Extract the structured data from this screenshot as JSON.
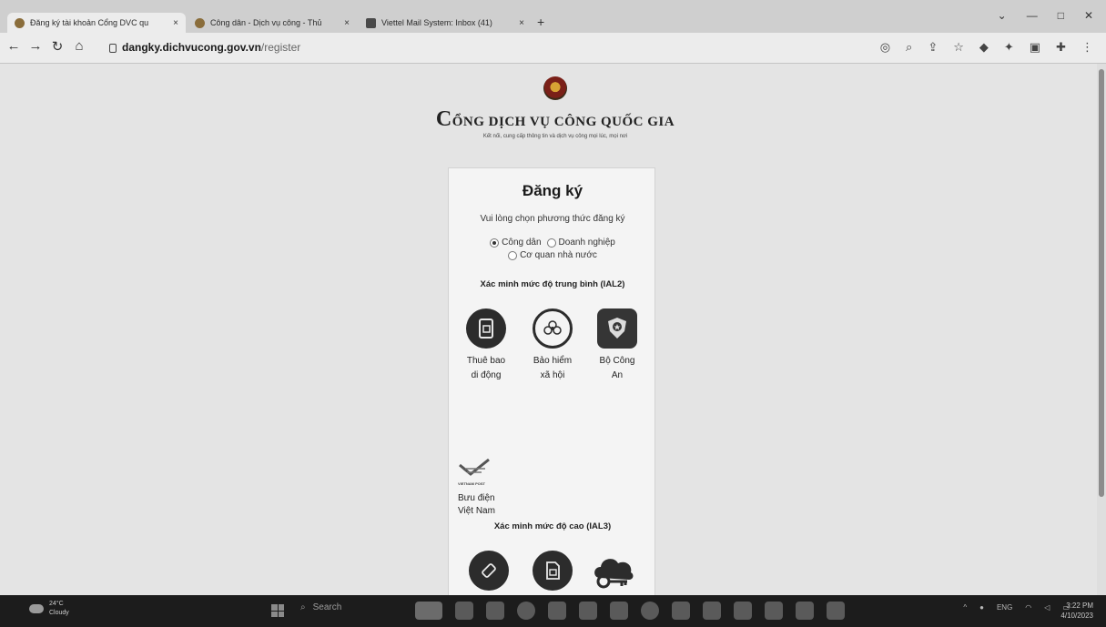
{
  "browser": {
    "tabs": [
      {
        "title": "Đăng ký tài khoản Cổng DVC qu",
        "favicon_color": "#8a6d3b",
        "active": true
      },
      {
        "title": "Công dân - Dịch vụ công - Thủ",
        "favicon_color": "#8a6d3b",
        "active": false
      },
      {
        "title": "Viettel Mail System: Inbox (41)",
        "favicon_color": "#4a4a4a",
        "active": false
      }
    ],
    "close_glyph": "×",
    "new_tab_glyph": "+",
    "address": {
      "domain": "dangky.dichvucong.gov.vn",
      "path": "/register"
    }
  },
  "portal": {
    "title_initial": "C",
    "title_rest": "ỔNG DỊCH VỤ CÔNG QUỐC GIA",
    "subtitle": "Kết nối, cung cấp thông tin và dịch vụ công mọi lúc, mọi nơi"
  },
  "register": {
    "title": "Đăng ký",
    "subtitle": "Vui lòng chọn phương thức đăng ký",
    "options": [
      {
        "label": "Công dân",
        "checked": true
      },
      {
        "label": "Doanh nghiệp",
        "checked": false
      },
      {
        "label": "Cơ quan nhà nước",
        "checked": false
      }
    ],
    "ial2_title": "Xác minh mức độ trung bình (IAL2)",
    "ial2_providers": [
      {
        "line1": "Thuê bao",
        "line2": "di động",
        "icon": "phone-sim-icon"
      },
      {
        "line1": "Bảo hiểm",
        "line2": "xã hội",
        "icon": "social-insurance-icon"
      },
      {
        "line1": "Bộ Công",
        "line2": "An",
        "icon": "police-badge-icon"
      }
    ],
    "vn_post": {
      "logo_text": "VIETNAM POST",
      "line1": "Bưu điện",
      "line2": "Việt Nam"
    },
    "ial3_title": "Xác minh mức độ cao (IAL3)"
  },
  "taskbar": {
    "temp": "24°C",
    "weather": "Cloudy",
    "search": "Search",
    "lang": "ENG",
    "time": "3:22 PM",
    "date": "4/10/2023"
  }
}
